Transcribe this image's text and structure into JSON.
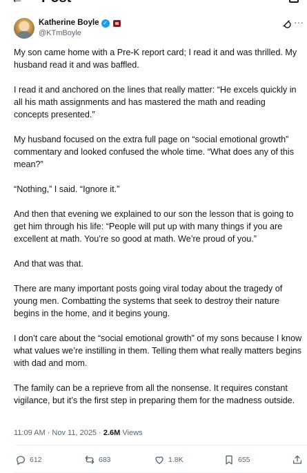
{
  "topbar": {
    "back_glyph": "←",
    "title": "Post"
  },
  "author": {
    "name": "Katherine Boyle",
    "handle": "@KTmBoyle",
    "verified_glyph": "✓"
  },
  "tweet": {
    "paragraphs": [
      "My son came home with a Pre-K report card; I read it and was thrilled. My husband read it and was baffled.",
      "I read it and anchored on the lines that really matter: “He excels quickly in all his math assignments and has mastered the math and reading concepts presented.”",
      "My husband focused on the extra full page on “social emotional growth” commentary and looked confused the whole time. “What does any of this mean?”",
      "“Nothing,” I said. “Ignore it.”",
      "And then that evening we explained to our son the lesson that is going to get him through his life: “People will put up with many things if you are excellent at math. You’re so good at math. We’re proud of you.”",
      "And that was that.",
      "There are many important posts going viral today about the tragedy of young men. Combatting the systems that seek to destroy their nature begins in the home, and it begins young.",
      "I don’t care about the “social emotional growth” of my sons because I know what values we’re instilling in them. Telling them what really matters begins with dad and mom.",
      "The family can be a reprieve from all the nonsense. It requires constant vigilance, but it’s the first step in preparing them for the madness outside."
    ],
    "timestamp": "11:09 AM · Nov 11, 2025 · ",
    "views_count": "2.6M",
    "views_label": " Views"
  },
  "actions": {
    "replies": "612",
    "reposts": "683",
    "likes": "1.8K",
    "bookmarks": "655"
  },
  "icons": {
    "more": "more-horizontal-icon",
    "grok": "grok-icon",
    "reply": "reply-icon",
    "repost": "repost-icon",
    "like": "heart-icon",
    "bookmark": "bookmark-icon",
    "share": "share-icon"
  },
  "colors": {
    "text": "#0f1419",
    "secondary": "#536471",
    "verified": "#1d9bf0",
    "divider": "#eff3f4"
  }
}
